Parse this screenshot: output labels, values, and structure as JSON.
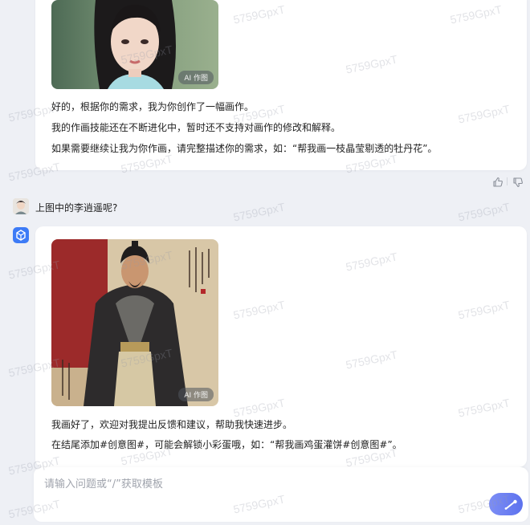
{
  "watermark": "5759GpxT",
  "conversation": {
    "first_reply": {
      "image_badge": "AI 作图",
      "lines": [
        "好的，根据你的需求，我为你创作了一幅画作。",
        "我的作画技能还在不断进化中，暂时还不支持对画作的修改和解释。",
        "如果需要继续让我为你作画，请完整描述你的需求，如：“帮我画一枝晶莹剔透的牡丹花”。"
      ]
    },
    "user_message": "上图中的李逍遥呢?",
    "second_reply": {
      "image_badge": "AI 作图",
      "lines": [
        "我画好了，欢迎对我提出反馈和建议，帮助我快速进步。",
        "在结尾添加#创意图#，可能会解锁小彩蛋哦，如：“帮我画鸡蛋灌饼#创意图#”。"
      ]
    }
  },
  "feedback": {
    "like_icon": "thumbs-up-icon",
    "dislike_icon": "thumbs-down-icon"
  },
  "input": {
    "placeholder": "请输入问题或“/”获取模板",
    "send_icon": "send-icon"
  },
  "colors": {
    "background": "#eef0f5",
    "bot_avatar": "#3d7bf6",
    "send_button": "#6a7ef0"
  }
}
